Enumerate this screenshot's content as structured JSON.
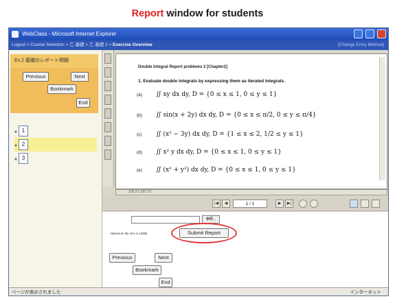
{
  "caption": {
    "accent": "Report",
    "rest": " window for students"
  },
  "window": {
    "title": "WebClass - Microsoft Internet Explorer",
    "breadcrumb": "Logout > Course Selection > 乙 基礎 > 乙 基礎 2 > ",
    "breadcrumb_current": "Exercise Overview",
    "breadcrumb_right": "[Change Entry Method]"
  },
  "left_pane": {
    "task_label": "Ex.2    基礎のレポート問題",
    "buttons": {
      "previous": "Previous",
      "next": "Next",
      "bookmark": "Bookmark",
      "end": "End"
    },
    "questions": [
      "1",
      "2",
      "3"
    ],
    "selected_question": "2"
  },
  "document": {
    "header": "Double Integral    Report problems 2      [Chapter2]",
    "problem": "1.    Evaluate double integrals by expressing them as iterated integrals.",
    "items": [
      {
        "label": "(a)",
        "expr": "∬ xy dx dy,  D = {0 ≤ x ≤ 1, 0 ≤ y ≤ 1}"
      },
      {
        "label": "(b)",
        "expr": "∬ sin(x + 2y) dx dy,  D = {0 ≤ x ≤ π/2, 0 ≤ y ≤ π/4}"
      },
      {
        "label": "(c)",
        "expr": "∬ (x² − 3y) dx dy,  D = {1 ≤ x ≤ 2, 1/2 ≤ y ≤ 1}"
      },
      {
        "label": "(d)",
        "expr": "∬ x² y dx dy,  D = {0 ≤ x ≤ 1, 0 ≤ y ≤ 1}"
      },
      {
        "label": "(e)",
        "expr": "∬ (x² + y²) dx dy,  D = {0 ≤ x ≤ 1, 0 ≤ y ≤ 1}"
      }
    ],
    "scroll_status": "100.0 x 297.73"
  },
  "pager": {
    "first": "|◀",
    "prev": "◀",
    "page": "1 / 1",
    "next": "▶",
    "last": "▶|"
  },
  "submit_area": {
    "browse_label": "参照...",
    "note": "Maximum file size is 10MB",
    "submit_label": "Submit Report",
    "buttons": {
      "previous": "Previous",
      "next": "Next",
      "bookmark": "Bookmark",
      "end": "End"
    }
  },
  "status": {
    "left": "ページが表示されました",
    "right": "インターネット"
  }
}
